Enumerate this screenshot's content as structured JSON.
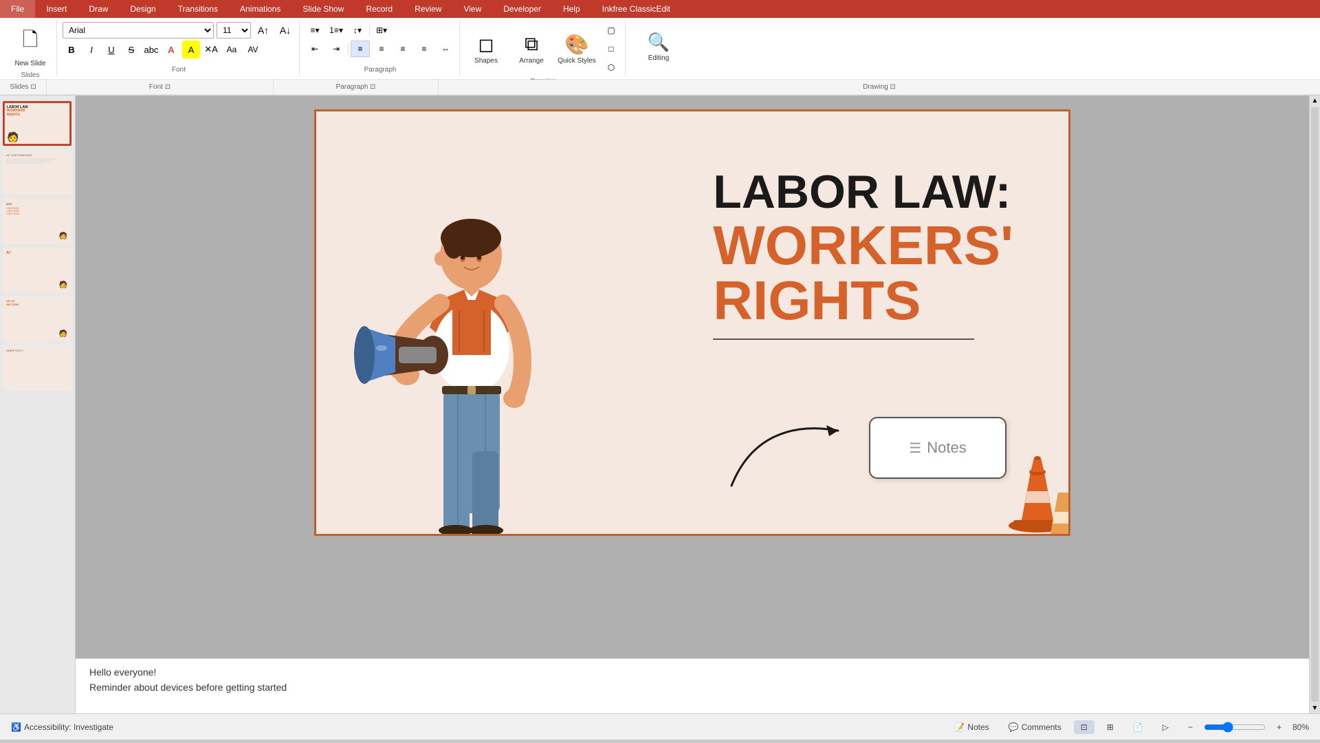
{
  "titlebar": {
    "tabs": [
      "File",
      "Insert",
      "Draw",
      "Design",
      "Transitions",
      "Animations",
      "Slide Show",
      "Record",
      "Review",
      "View",
      "Developer",
      "Help",
      "Inkfree ClassicEdit"
    ]
  },
  "ribbon": {
    "slides_group_label": "Slides",
    "new_slide_label": "New\nSlide",
    "font_group_label": "Font",
    "paragraph_group_label": "Paragraph",
    "drawing_group_label": "Drawing",
    "font_name": "Arial",
    "font_size": "11",
    "bold_label": "B",
    "italic_label": "I",
    "underline_label": "U",
    "strikethrough_label": "S",
    "shapes_label": "Shapes",
    "arrange_label": "Arrange",
    "quick_styles_label": "Quick\nStyles",
    "editing_label": "Editing"
  },
  "slides": [
    {
      "id": 1,
      "active": true,
      "title": "LABOR LAW:",
      "subtitle": "WORKERS'\nRIGHTS"
    },
    {
      "id": 2,
      "active": false,
      "title": "OF THIS TEMPLATE"
    },
    {
      "id": 3,
      "active": false,
      "title": "NTS"
    },
    {
      "id": 4,
      "active": false,
      "title": "A!"
    },
    {
      "id": 5,
      "active": false,
      "title": "GE OF\nSECTION"
    },
    {
      "id": 6,
      "active": false,
      "title": "NGER TEXT?"
    }
  ],
  "slide_content": {
    "main_title": "LABOR LAW:",
    "sub_title_1": "WORKERS'",
    "sub_title_2": "RIGHTS",
    "divider": true
  },
  "notes_popup": {
    "label": "Notes"
  },
  "notes_bar": {
    "line1": "Hello everyone!",
    "line2": "Reminder about devices before getting started"
  },
  "status_bar": {
    "accessibility": "Accessibility: Investigate",
    "notes_btn": "Notes",
    "comments_btn": "Comments",
    "zoom_label": "80%",
    "slide_view_label": "Normal View"
  },
  "section_labels": {
    "slide3_section": "1 SECTION\n2 SECTION\n3 SECTION",
    "slide5_section": "GE OF SECTION"
  }
}
